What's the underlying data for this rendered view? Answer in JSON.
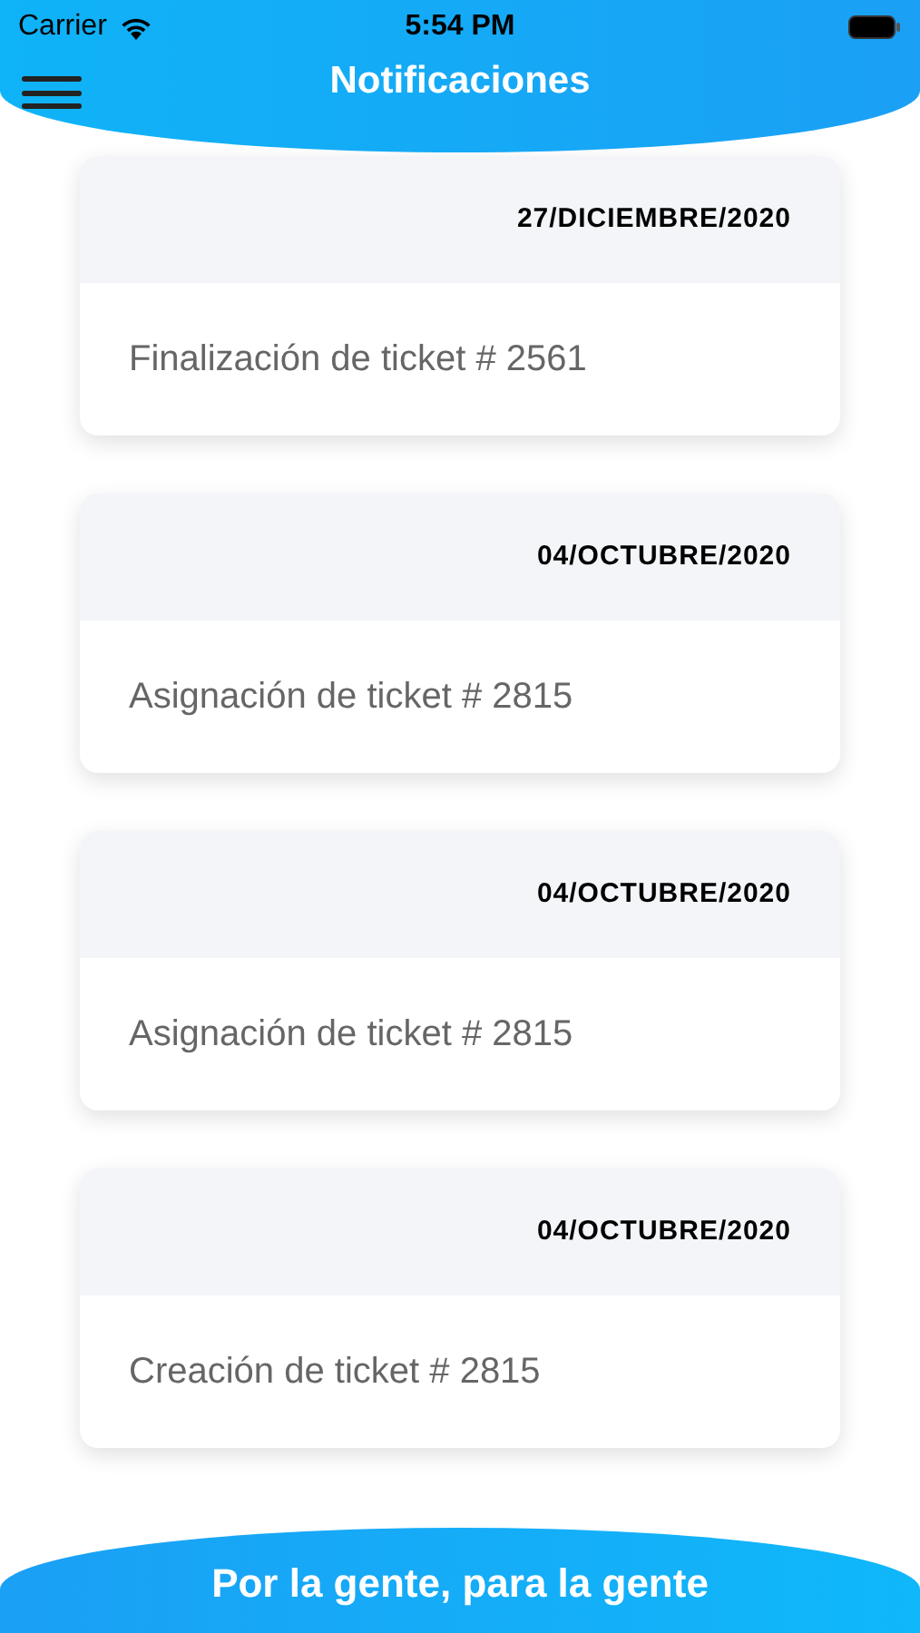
{
  "status_bar": {
    "carrier": "Carrier",
    "time": "5:54 PM"
  },
  "header": {
    "title": "Notificaciones"
  },
  "notifications": [
    {
      "date": "27/DICIEMBRE/2020",
      "message": "Finalización de ticket # 2561"
    },
    {
      "date": "04/OCTUBRE/2020",
      "message": "Asignación de ticket # 2815"
    },
    {
      "date": "04/OCTUBRE/2020",
      "message": "Asignación de ticket # 2815"
    },
    {
      "date": "04/OCTUBRE/2020",
      "message": "Creación de ticket # 2815"
    }
  ],
  "footer": {
    "slogan": "Por la gente, para la gente"
  }
}
